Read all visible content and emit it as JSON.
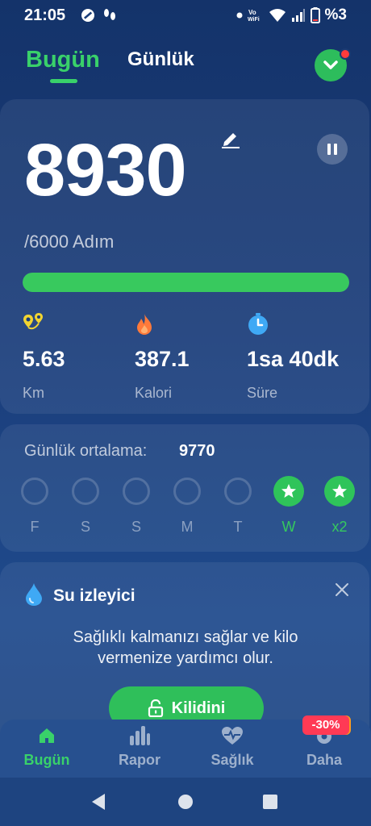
{
  "status_bar": {
    "time": "21:05",
    "battery": "%3",
    "icons": [
      "no-disturb-icon",
      "steps-icon",
      "dot-icon",
      "vowifi-icon",
      "wifi-icon",
      "signal-icon",
      "battery-icon"
    ]
  },
  "header": {
    "tab_today": "Bugün",
    "tab_daily": "Günlük",
    "action_icon": "chevron-down-icon"
  },
  "steps": {
    "count": "8930",
    "goal_text": "/6000 Adım",
    "progress": 1.0
  },
  "stats": [
    {
      "icon": "distance-icon",
      "value": "5.63",
      "label": "Km",
      "color": "#f2d531"
    },
    {
      "icon": "flame-icon",
      "value": "387.1",
      "label": "Kalori",
      "color": "#ff7a3a"
    },
    {
      "icon": "timer-icon",
      "value": "1sa 40dk",
      "label": "Süre",
      "color": "#3fa9f5"
    }
  ],
  "average": {
    "label": "Günlük ortalama:",
    "value": "9770",
    "days": [
      {
        "label": "F",
        "done": false
      },
      {
        "label": "S",
        "done": false
      },
      {
        "label": "S",
        "done": false
      },
      {
        "label": "M",
        "done": false
      },
      {
        "label": "T",
        "done": false
      },
      {
        "label": "W",
        "done": true
      },
      {
        "label": "x2",
        "done": true
      }
    ]
  },
  "water": {
    "title": "Su izleyici",
    "description": "Sağlıklı kalmanızı sağlar ve kilo vermenize yardımcı olur.",
    "button": "Kilidini"
  },
  "bottom_nav": {
    "items": [
      {
        "label": "Bugün",
        "icon": "home-icon",
        "active": true
      },
      {
        "label": "Rapor",
        "icon": "bar-chart-icon",
        "active": false
      },
      {
        "label": "Sağlık",
        "icon": "heart-pulse-icon",
        "active": false
      },
      {
        "label": "Daha",
        "icon": "gear-icon",
        "active": false
      }
    ],
    "promo_badge": "-30%"
  },
  "colors": {
    "accent": "#39d16a",
    "background": "#1a3d7a"
  }
}
